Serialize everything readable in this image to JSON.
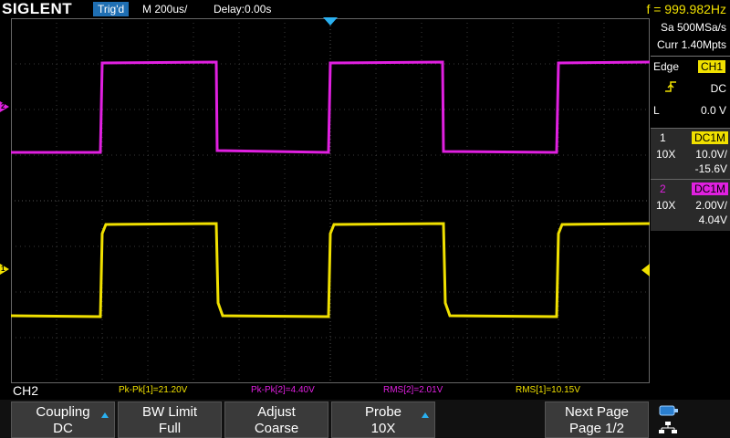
{
  "header": {
    "logo": "SIGLENT",
    "trigger_status": "Trig'd",
    "timebase": "M 200us/",
    "delay": "Delay:0.00s",
    "frequency": "f = 999.982Hz"
  },
  "acquisition": {
    "sample_rate": "Sa 500MSa/s",
    "memory": "Curr 1.40Mpts"
  },
  "trigger": {
    "type": "Edge",
    "source": "CH1",
    "coupling": "DC",
    "level_label": "L",
    "level": "0.0 V"
  },
  "channels": [
    {
      "number": "1",
      "coupling": "DC1M",
      "probe": "10X",
      "scale": "10.0V/",
      "offset": "-15.6V",
      "color": "#f0e000"
    },
    {
      "number": "2",
      "coupling": "DC1M",
      "probe": "10X",
      "scale": "2.00V/",
      "offset": "4.04V",
      "color": "#e020e0"
    }
  ],
  "markers": {
    "ch1": "1",
    "ch2": "2"
  },
  "active_channel": "CH2",
  "measurements": [
    {
      "label": "Pk-Pk[1]=21.20V",
      "color": "#f0e000"
    },
    {
      "label": "Pk-Pk[2]=4.40V",
      "color": "#e020e0"
    },
    {
      "label": "RMS[2]=2.01V",
      "color": "#e020e0"
    },
    {
      "label": "RMS[1]=10.15V",
      "color": "#f0e000"
    }
  ],
  "menu": {
    "coupling": {
      "title": "Coupling",
      "value": "DC"
    },
    "bw_limit": {
      "title": "BW Limit",
      "value": "Full"
    },
    "adjust": {
      "title": "Adjust",
      "value": "Coarse"
    },
    "probe": {
      "title": "Probe",
      "value": "10X"
    },
    "next_page": {
      "title": "Next Page",
      "value": "Page 1/2"
    }
  }
}
